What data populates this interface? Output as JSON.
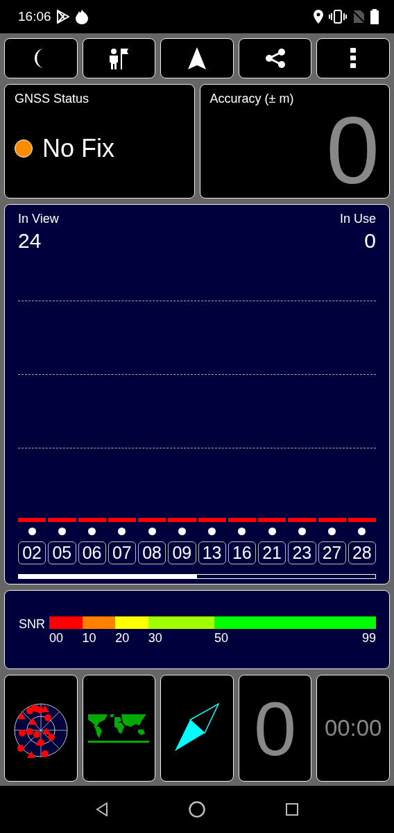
{
  "status_bar": {
    "time": "16:06"
  },
  "gnss_status": {
    "title": "GNSS Status",
    "fix": "No Fix"
  },
  "accuracy": {
    "title": "Accuracy (± m)",
    "value": "0"
  },
  "sky": {
    "in_view_label": "In View",
    "in_view": "24",
    "in_use_label": "In Use",
    "in_use": "0",
    "satellites": [
      {
        "prn": "02"
      },
      {
        "prn": "05"
      },
      {
        "prn": "06"
      },
      {
        "prn": "07"
      },
      {
        "prn": "08"
      },
      {
        "prn": "09"
      },
      {
        "prn": "13"
      },
      {
        "prn": "16"
      },
      {
        "prn": "21"
      },
      {
        "prn": "23"
      },
      {
        "prn": "27"
      },
      {
        "prn": "28"
      }
    ]
  },
  "snr": {
    "label": "SNR",
    "segments": [
      {
        "tick": "00",
        "color": "#ff0000"
      },
      {
        "tick": "10",
        "color": "#ff8000"
      },
      {
        "tick": "20",
        "color": "#ffff00"
      },
      {
        "tick": "30",
        "color": "#a0ff00"
      },
      {
        "tick": "50",
        "color": "#00ff00"
      }
    ],
    "end_tick": "99"
  },
  "tiles": {
    "count": "0",
    "timer": "00:00"
  }
}
